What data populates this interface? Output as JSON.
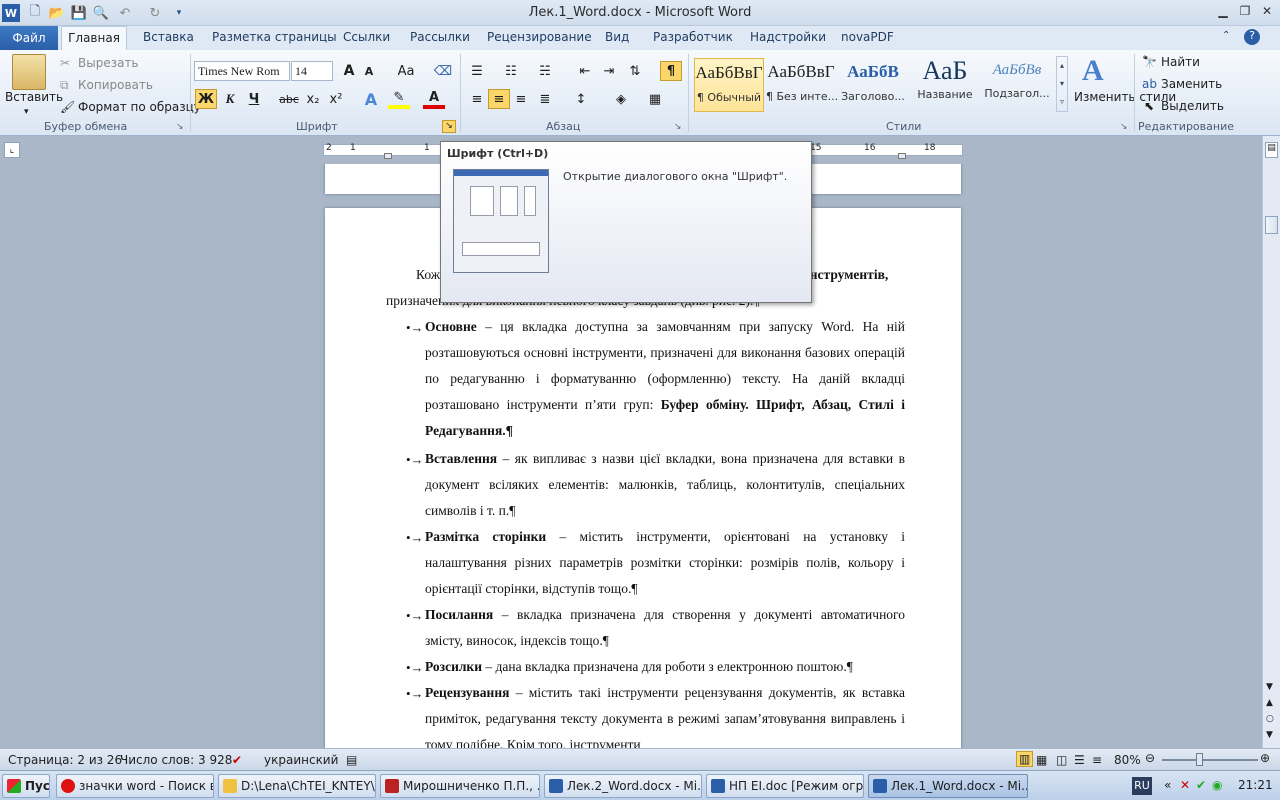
{
  "window": {
    "title": "Лек.1_Word.docx  -  Microsoft Word"
  },
  "tabs": {
    "file": "Файл",
    "items": [
      "Главная",
      "Вставка",
      "Разметка страницы",
      "Ссылки",
      "Рассылки",
      "Рецензирование",
      "Вид",
      "Разработчик",
      "Надстройки",
      "novaPDF"
    ]
  },
  "clipboard": {
    "paste": "Вставить",
    "cut": "Вырезать",
    "copy": "Копировать",
    "format_painter": "Формат по образцу",
    "label": "Буфер обмена"
  },
  "font": {
    "name": "Times New Rom",
    "size": "14",
    "label": "Шрифт",
    "bold": "Ж",
    "italic": "К",
    "underline": "Ч",
    "strike": "abc",
    "sub": "x₂",
    "sup": "x²",
    "grow": "A",
    "shrink": "A",
    "case": "Aa"
  },
  "paragraph": {
    "label": "Абзац",
    "pilcrow": "¶"
  },
  "styles": {
    "label": "Стили",
    "items": [
      {
        "sample": "АаБбВвГ",
        "name": "¶ Обычный"
      },
      {
        "sample": "АаБбВвГ",
        "name": "¶ Без инте..."
      },
      {
        "sample": "АаБбВ",
        "name": "Заголово..."
      },
      {
        "sample": "АаБ",
        "name": "Название"
      },
      {
        "sample": "АаБбВв",
        "name": "Подзагол..."
      }
    ],
    "change": "Изменить стили"
  },
  "editing": {
    "find": "Найти",
    "replace": "Заменить",
    "select": "Выделить",
    "label": "Редактирование"
  },
  "ruler": {
    "numbers": [
      "2",
      "1",
      "1",
      "2",
      "15",
      "16",
      "18"
    ]
  },
  "tooltip": {
    "title": "Шрифт (Ctrl+D)",
    "description": "Открытие диалогового окна \"Шрифт\"."
  },
  "document": {
    "intro1": "Кож",
    "intro1_right": "інструментів,",
    "intro2": "призначених для виконання певного класу завдань (див. рис. 2).¶",
    "items": [
      {
        "bold": "Основне",
        "text": " – ця вкладка доступна за замовчанням при запуску Word. На ній розташовуються основні інструменти, призначені для виконання базових операцій по редагуванню і форматуванню (оформленню) тексту. На даній вкладці розташовано інструменти п’яти груп: ",
        "tail": "Буфер обміну. Шрифт, Абзац, Стилі і Редагування.¶"
      },
      {
        "bold": "Вставлення",
        "text": " – як випливає з назви цієї вкладки, вона призначена для вставки в документ всіляких елементів: малюнків, таблиць, колонтитулів, спеціальних символів і т. п.¶",
        "tail": ""
      },
      {
        "bold": "Размітка сторінки",
        "text": " – містить інструменти, орієнтовані на установку і налаштування різних параметрів розмітки сторінки: розмірів полів, кольору і орієнтації сторінки, відступів тощо.¶",
        "tail": ""
      },
      {
        "bold": "Посилання",
        "text": " – вкладка призначена для створення у документі автоматичного змісту, виносок, індексів тощо.¶",
        "tail": ""
      },
      {
        "bold": "Розсилки",
        "text": " – дана вкладка призначена для роботи з електронною поштою.¶",
        "tail": ""
      },
      {
        "bold": "Рецензування",
        "text": " – містить такі інструменти рецензування документів, як вставка приміток, редагування тексту документа в режимі запам’ятовування виправлень і тому подібне. Крім того, інструменти",
        "tail": ""
      }
    ],
    "bullet": "•→"
  },
  "status": {
    "page": "Страница: 2 из 26",
    "words": "Число слов: 3 928",
    "lang": "украинский",
    "zoom": "80%"
  },
  "taskbar": {
    "start": "Пуск",
    "items": [
      "значки word - Поиск в...",
      "D:\\Lena\\ChTEI_KNTEY\\...",
      "Мирошниченко П.П., ...",
      "Лек.2_Word.docx - Mi...",
      "НП ЕІ.doc [Режим огр...",
      "Лек.1_Word.docx - Mi..."
    ],
    "lang": "RU",
    "time": "21:21"
  },
  "colors": {
    "accent": "#2a5ea8",
    "highlight": "#ffff00",
    "font_color": "#e00000"
  }
}
